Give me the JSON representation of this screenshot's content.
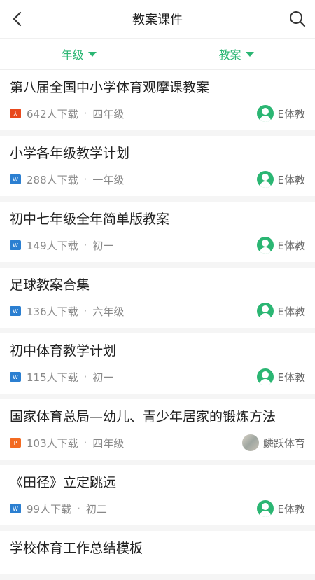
{
  "header": {
    "title": "教案课件",
    "back_icon": "back-arrow-icon",
    "search_icon": "search-icon"
  },
  "filters": [
    {
      "label": "年级"
    },
    {
      "label": "教案"
    }
  ],
  "items": [
    {
      "title": "第八届全国中小学体育观摩课教案",
      "file_type": "pdf",
      "downloads": "642人下载",
      "grade": "四年级",
      "author": "E体教"
    },
    {
      "title": "小学各年级教学计划",
      "file_type": "doc",
      "downloads": "288人下载",
      "grade": "一年级",
      "author": "E体教"
    },
    {
      "title": "初中七年级全年简单版教案",
      "file_type": "doc",
      "downloads": "149人下载",
      "grade": "初一",
      "author": "E体教"
    },
    {
      "title": "足球教案合集",
      "file_type": "doc",
      "downloads": "136人下载",
      "grade": "六年级",
      "author": "E体教"
    },
    {
      "title": "初中体育教学计划",
      "file_type": "doc",
      "downloads": "115人下载",
      "grade": "初一",
      "author": "E体教"
    },
    {
      "title": "国家体育总局—幼儿、青少年居家的锻炼方法",
      "file_type": "ppt",
      "downloads": "103人下载",
      "grade": "四年级",
      "author": "鳞跃体育"
    },
    {
      "title": "《田径》立定跳远",
      "file_type": "doc",
      "downloads": "99人下载",
      "grade": "初二",
      "author": "E体教"
    },
    {
      "title": "学校体育工作总结模板",
      "file_type": "doc",
      "downloads": "",
      "grade": "",
      "author": ""
    }
  ],
  "file_icon_text": {
    "pdf": "⅄",
    "doc": "W",
    "ppt": "P"
  },
  "colors": {
    "accent": "#2bb673"
  }
}
